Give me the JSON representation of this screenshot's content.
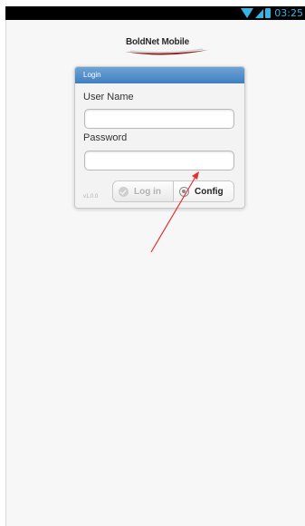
{
  "status_bar": {
    "time": "03:25",
    "icon_color": "#33b5e5",
    "icons": [
      "wifi-icon",
      "signal-icon",
      "battery-icon"
    ]
  },
  "logo": {
    "text": "BoldNet Mobile"
  },
  "login_panel": {
    "title": "Login",
    "header_color": "#4a88c6",
    "username_label": "User Name",
    "username_value": "",
    "password_label": "Password",
    "password_value": "",
    "version": "v1.0.0",
    "login_button": "Log in",
    "config_button": "Config"
  },
  "annotation": {
    "arrow_color": "#e53030"
  }
}
